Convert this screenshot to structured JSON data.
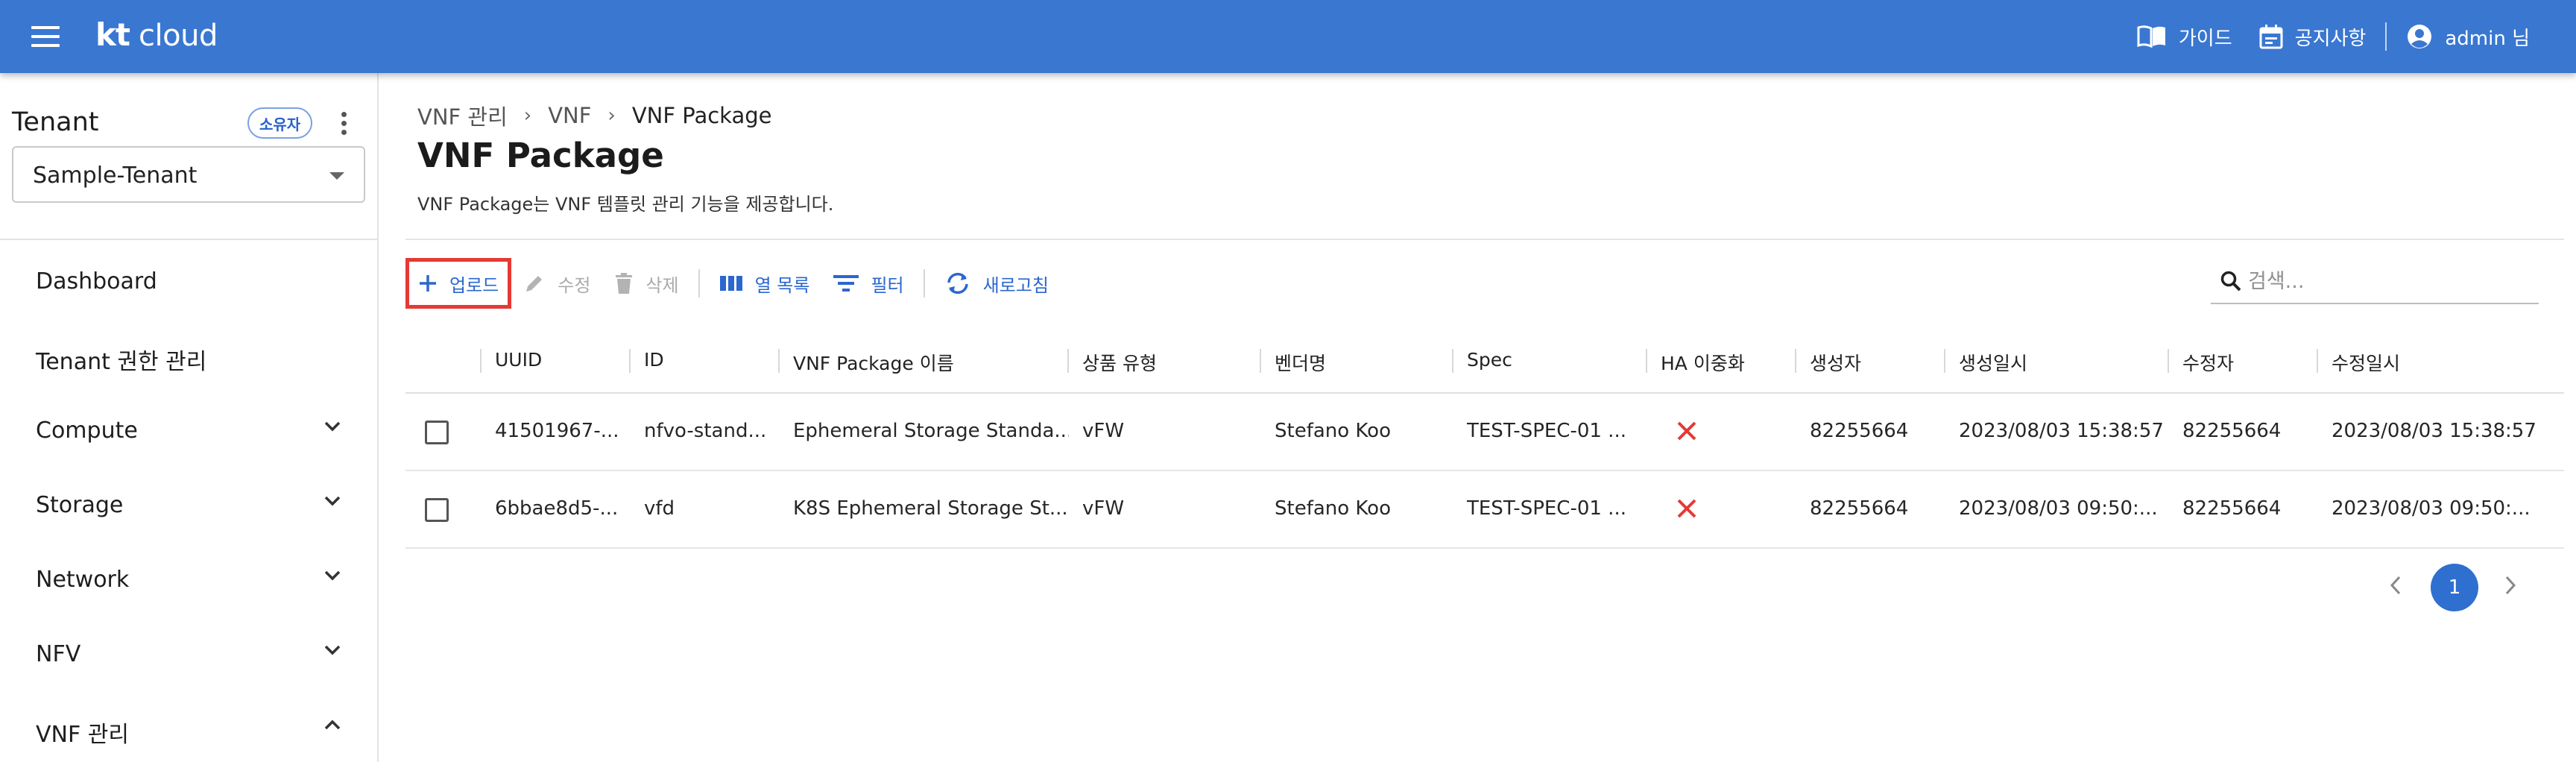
{
  "header": {
    "brand_kt": "kt",
    "brand_cloud": "cloud",
    "guide_label": "가이드",
    "notice_label": "공지사항",
    "user_label": "admin 님"
  },
  "sidebar": {
    "tenant_title": "Tenant",
    "owner_badge": "소유자",
    "tenant_selected": "Sample-Tenant",
    "items": [
      {
        "label": "Dashboard",
        "chevron": "none"
      },
      {
        "label": "Tenant 권한 관리",
        "chevron": "none"
      },
      {
        "label": "Compute",
        "chevron": "down"
      },
      {
        "label": "Storage",
        "chevron": "down"
      },
      {
        "label": "Network",
        "chevron": "down"
      },
      {
        "label": "NFV",
        "chevron": "down"
      },
      {
        "label": "VNF 관리",
        "chevron": "up"
      }
    ]
  },
  "breadcrumb": [
    "VNF 관리",
    "VNF",
    "VNF Package"
  ],
  "page": {
    "title": "VNF Package",
    "description": "VNF Package는 VNF 템플릿 관리 기능을 제공합니다."
  },
  "toolbar": {
    "upload": "업로드",
    "edit": "수정",
    "delete": "삭제",
    "columns": "열 목록",
    "filter": "필터",
    "refresh": "새로고침"
  },
  "search": {
    "placeholder": "검색...",
    "value": ""
  },
  "table": {
    "headers": [
      "UUID",
      "ID",
      "VNF Package 이름",
      "상품 유형",
      "벤더명",
      "Spec",
      "HA 이중화",
      "생성자",
      "생성일시",
      "수정자",
      "수정일시"
    ],
    "rows": [
      {
        "uuid": "41501967-...",
        "id": "nfvo-stand...",
        "name": "Ephemeral Storage Standa...",
        "type": "vFW",
        "vendor": "Stefano Koo",
        "spec": "TEST-SPEC-01 ...",
        "ha": false,
        "creator": "82255664",
        "created": "2023/08/03 15:38:57",
        "modifier": "82255664",
        "modified": "2023/08/03 15:38:57"
      },
      {
        "uuid": "6bbae8d5-...",
        "id": "vfd",
        "name": "K8S Ephemeral Storage St...",
        "type": "vFW",
        "vendor": "Stefano Koo",
        "spec": "TEST-SPEC-01 ...",
        "ha": false,
        "creator": "82255664",
        "created": "2023/08/03 09:50:...",
        "modifier": "82255664",
        "modified": "2023/08/03 09:50:..."
      }
    ]
  },
  "pagination": {
    "current": "1"
  },
  "colors": {
    "appbar": "#3a77d1",
    "accent": "#2b67cf",
    "highlight": "#e53935",
    "x_mark": "#e53935"
  }
}
